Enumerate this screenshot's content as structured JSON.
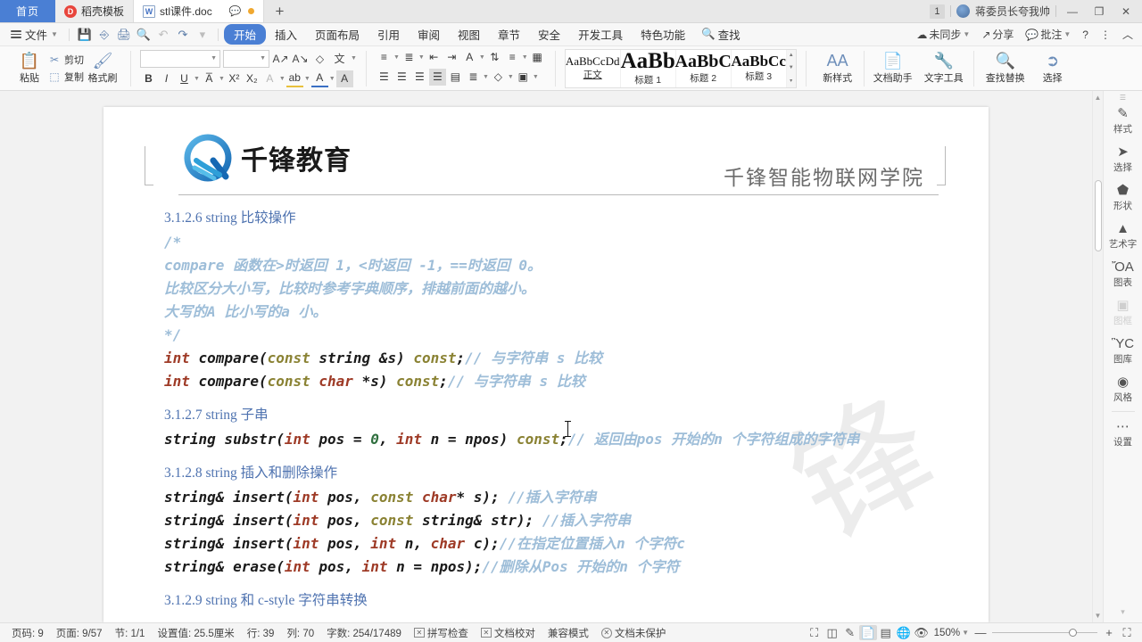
{
  "tabbar": {
    "home_label": "首页",
    "tabs": [
      {
        "label": "稻壳模板",
        "icon": "dao-ke-icon"
      },
      {
        "label": "stl课件.doc",
        "icon": "word-doc-icon"
      }
    ],
    "add_label": "+",
    "notification_count": "1",
    "user_name": "蒋委员长夸我帅",
    "window_minimize": "—",
    "window_restore": "❐",
    "window_close": "✕"
  },
  "menubar": {
    "file_label": "文件",
    "quick_icons": [
      "save-icon",
      "save-as-cloud-icon",
      "print-icon",
      "print-preview-icon",
      "undo-icon",
      "redo-icon",
      "customize-icon"
    ],
    "items": [
      {
        "label": "开始",
        "active": true
      },
      {
        "label": "插入",
        "active": false
      },
      {
        "label": "页面布局",
        "active": false
      },
      {
        "label": "引用",
        "active": false
      },
      {
        "label": "审阅",
        "active": false
      },
      {
        "label": "视图",
        "active": false
      },
      {
        "label": "章节",
        "active": false
      },
      {
        "label": "安全",
        "active": false
      },
      {
        "label": "开发工具",
        "active": false
      },
      {
        "label": "特色功能",
        "active": false
      }
    ],
    "find_label": "查找",
    "right_items": [
      {
        "label": "未同步",
        "icon": "cloud-sync-icon"
      },
      {
        "label": "分享",
        "icon": "share-icon"
      },
      {
        "label": "批注",
        "icon": "comment-icon"
      }
    ],
    "help_icon": "?",
    "more_icon": "⋮",
    "collapse_icon": "︿"
  },
  "ribbon": {
    "paste_label": "粘贴",
    "cut_label": "剪切",
    "copy_label": "复制",
    "format_painter_label": "格式刷",
    "font_name": "",
    "font_name_placeholder": "",
    "font_size": "",
    "font_size_placeholder": "",
    "styles": [
      {
        "preview": "AaBbCcDd",
        "name": "正文",
        "selected": true,
        "size": "13px"
      },
      {
        "preview": "AaBb",
        "name": "标题 1",
        "selected": false,
        "size": "25px"
      },
      {
        "preview": "AaBbC",
        "name": "标题 2",
        "selected": false,
        "size": "20px"
      },
      {
        "preview": "AaBbCc",
        "name": "标题 3",
        "selected": false,
        "size": "17px"
      }
    ],
    "new_style_label": "新样式",
    "doc_assistant_label": "文档助手",
    "text_tools_label": "文字工具",
    "find_replace_label": "查找替换",
    "select_label": "选择"
  },
  "document": {
    "header": {
      "logo_text": "千锋教育",
      "right_text": "千锋智能物联网学院"
    },
    "watermark": "锋",
    "blocks": [
      {
        "type": "heading",
        "text": "3.1.2.6 string 比较操作"
      },
      {
        "type": "comment",
        "text": "/*"
      },
      {
        "type": "comment",
        "text": "compare 函数在>时返回 1，<时返回 -1，==时返回 0。"
      },
      {
        "type": "comment",
        "text": "比较区分大小写，比较时参考字典顺序，排越前面的越小。"
      },
      {
        "type": "comment",
        "text": "大写的A 比小写的a 小。"
      },
      {
        "type": "comment",
        "text": "*/"
      },
      {
        "type": "code",
        "parts": [
          {
            "t": "int ",
            "c": "kw"
          },
          {
            "t": "compare(",
            "c": ""
          },
          {
            "t": "const ",
            "c": "kw2"
          },
          {
            "t": "string &s) ",
            "c": ""
          },
          {
            "t": "const",
            "c": "kw2"
          },
          {
            "t": ";",
            "c": ""
          },
          {
            "t": "// 与字符串 s 比较",
            "c": "cc"
          }
        ]
      },
      {
        "type": "code",
        "parts": [
          {
            "t": "int ",
            "c": "kw"
          },
          {
            "t": "compare(",
            "c": ""
          },
          {
            "t": "const ",
            "c": "kw2"
          },
          {
            "t": "char ",
            "c": "kw"
          },
          {
            "t": "*s) ",
            "c": ""
          },
          {
            "t": "const",
            "c": "kw2"
          },
          {
            "t": ";",
            "c": ""
          },
          {
            "t": "// 与字符串 s 比较",
            "c": "cc"
          }
        ]
      },
      {
        "type": "blank"
      },
      {
        "type": "heading",
        "text": "3.1.2.7 string 子串"
      },
      {
        "type": "code",
        "parts": [
          {
            "t": "string substr(",
            "c": ""
          },
          {
            "t": "int ",
            "c": "kw"
          },
          {
            "t": "pos = ",
            "c": ""
          },
          {
            "t": "0",
            "c": "num"
          },
          {
            "t": ", ",
            "c": ""
          },
          {
            "t": "int ",
            "c": "kw"
          },
          {
            "t": "n = npos) ",
            "c": ""
          },
          {
            "t": "const",
            "c": "kw2"
          },
          {
            "t": ";",
            "c": ""
          },
          {
            "t": "// 返回由pos 开始的n 个字符组成的字符串",
            "c": "cc"
          }
        ]
      },
      {
        "type": "blank"
      },
      {
        "type": "heading",
        "text": "3.1.2.8 string 插入和删除操作"
      },
      {
        "type": "code",
        "parts": [
          {
            "t": "string& insert(",
            "c": ""
          },
          {
            "t": "int ",
            "c": "kw"
          },
          {
            "t": "pos, ",
            "c": ""
          },
          {
            "t": "const ",
            "c": "kw2"
          },
          {
            "t": "char",
            "c": "kw"
          },
          {
            "t": "* s); ",
            "c": ""
          },
          {
            "t": "//插入字符串",
            "c": "cc"
          }
        ]
      },
      {
        "type": "code",
        "parts": [
          {
            "t": "string& insert(",
            "c": ""
          },
          {
            "t": "int ",
            "c": "kw"
          },
          {
            "t": "pos, ",
            "c": ""
          },
          {
            "t": "const ",
            "c": "kw2"
          },
          {
            "t": "string& str); ",
            "c": ""
          },
          {
            "t": "//插入字符串",
            "c": "cc"
          }
        ]
      },
      {
        "type": "code",
        "parts": [
          {
            "t": "string& insert(",
            "c": ""
          },
          {
            "t": "int ",
            "c": "kw"
          },
          {
            "t": "pos, ",
            "c": ""
          },
          {
            "t": "int ",
            "c": "kw"
          },
          {
            "t": "n, ",
            "c": ""
          },
          {
            "t": "char ",
            "c": "kw"
          },
          {
            "t": "c);",
            "c": ""
          },
          {
            "t": "//在指定位置插入n 个字符c",
            "c": "cc"
          }
        ]
      },
      {
        "type": "code",
        "parts": [
          {
            "t": "string& erase(",
            "c": ""
          },
          {
            "t": "int ",
            "c": "kw"
          },
          {
            "t": "pos, ",
            "c": ""
          },
          {
            "t": "int ",
            "c": "kw"
          },
          {
            "t": "n = npos);",
            "c": ""
          },
          {
            "t": "//删除从Pos 开始的n 个字符",
            "c": "cc"
          }
        ]
      },
      {
        "type": "blank"
      },
      {
        "type": "heading",
        "text": "3.1.2.9 string 和 c-style 字符串转换"
      }
    ]
  },
  "sidebar": {
    "items": [
      {
        "label": "样式",
        "icon": "pen-style-icon",
        "disabled": false
      },
      {
        "label": "选择",
        "icon": "cursor-select-icon",
        "disabled": false
      },
      {
        "label": "形状",
        "icon": "shapes-icon",
        "disabled": false
      },
      {
        "label": "艺术字",
        "icon": "wordart-icon",
        "disabled": false
      },
      {
        "label": "图表",
        "icon": "chart-icon",
        "disabled": false
      },
      {
        "label": "图框",
        "icon": "frame-icon",
        "disabled": true
      },
      {
        "label": "图库",
        "icon": "gallery-icon",
        "disabled": false
      },
      {
        "label": "风格",
        "icon": "theme-icon",
        "disabled": false
      },
      {
        "label": "设置",
        "icon": "settings-icon",
        "disabled": false
      }
    ]
  },
  "statusbar": {
    "page_number": "页码: 9",
    "page_of": "页面: 9/57",
    "section": "节: 1/1",
    "setting_value": "设置值: 25.5厘米",
    "row": "行: 39",
    "col": "列: 70",
    "word_count": "字数: 254/17489",
    "spell_check": "拼写检查",
    "doc_proof": "文档校对",
    "compat_mode": "兼容模式",
    "doc_unprotected": "文档未保护",
    "view_icons": [
      "fullscreen-icon",
      "two-page-icon",
      "edit-mode-icon",
      "page-view-icon",
      "outline-view-icon",
      "web-view-icon",
      "eye-protect-icon"
    ],
    "zoom_level": "150%",
    "zoom_out": "—",
    "zoom_in": "+",
    "fit_icon": "⛶"
  }
}
